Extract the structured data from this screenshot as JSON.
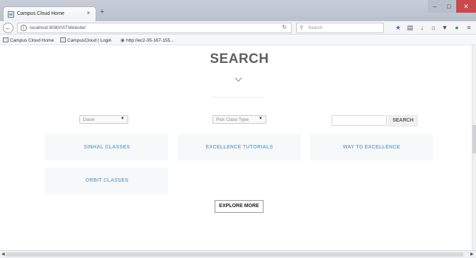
{
  "browser": {
    "tab_title": "Campus Cloud Home",
    "tab_close": "×",
    "new_tab": "+",
    "url": "localhost:8080/VITWebsite/",
    "search_placeholder": "Search",
    "window_controls": {
      "minimize": "–",
      "maximize": "□",
      "close": "✕"
    }
  },
  "bookmarks": [
    {
      "label": "Campus Cloud Home",
      "icon": "page-icon"
    },
    {
      "label": "CampusCloud | Login",
      "icon": "page-icon"
    },
    {
      "label": "http://ec2-35-167-155...",
      "icon": "globe-icon"
    }
  ],
  "page": {
    "heading": "SEARCH",
    "district_select": {
      "value": "Dacer"
    },
    "class_type_select": {
      "value": "Pick Class Type"
    },
    "search_input": {
      "value": ""
    },
    "search_button": "SEARCH",
    "cards": [
      "SINHAL CLASSES",
      "EXCELLENCE TUTORIALS",
      "WAY TO EXCELLENCE",
      "ORBIT CLASSES"
    ],
    "explore_button": "EXPLORE MORE"
  },
  "colors": {
    "heading": "#5f5f5f",
    "card_text": "#74a9d3",
    "card_bg": "#f7f8f9",
    "close_button": "#c94a4a"
  }
}
